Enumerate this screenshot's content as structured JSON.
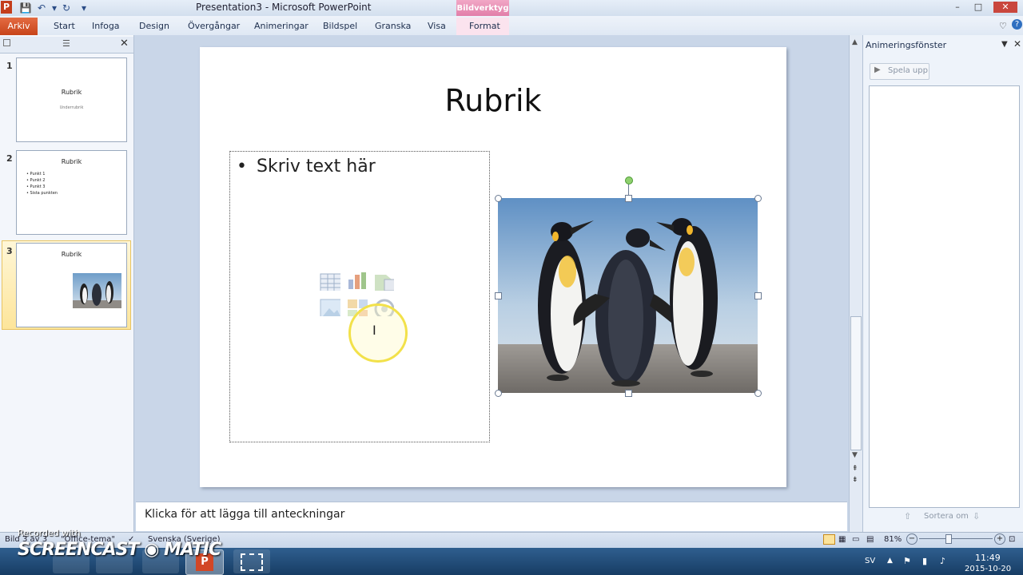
{
  "window": {
    "title": "Presentation3  -  Microsoft PowerPoint",
    "context_tab_group": "Bildverktyg",
    "controls": [
      "–",
      "□",
      "✕"
    ]
  },
  "ribbon": {
    "tabs": [
      "Arkiv",
      "Start",
      "Infoga",
      "Design",
      "Övergångar",
      "Animeringar",
      "Bildspel",
      "Granska",
      "Visa",
      "Format"
    ],
    "active_context_tab": "Format"
  },
  "slides_panel": {
    "thumbnails": [
      {
        "number": "1",
        "title": "Rubrik",
        "subtitle": "Underrubrik"
      },
      {
        "number": "2",
        "title": "Rubrik",
        "bullets": [
          "Punkt 1",
          "Punkt 2",
          "Punkt 3",
          "Sista punkten"
        ]
      },
      {
        "number": "3",
        "title": "Rubrik"
      }
    ],
    "selected_index": 3
  },
  "slide": {
    "title": "Rubrik",
    "bullet_symbol": "•",
    "content_text": "Skriv text här"
  },
  "notes": {
    "placeholder": "Klicka för att lägga till anteckningar"
  },
  "animation_pane": {
    "title": "Animeringsfönster",
    "play_button": "Spela upp",
    "sort_label": "Sortera om"
  },
  "status_bar": {
    "slide_info": "Bild 3 av 3",
    "theme": "\"Office-tema\"",
    "language": "Svenska (Sverige)",
    "zoom": "81%"
  },
  "taskbar": {
    "language": "SV",
    "time": "11:49",
    "date": "2015-10-20"
  },
  "watermark": {
    "line1": "Recorded with",
    "line2": "SCREENCAST ◉ MATIC"
  },
  "colors": {
    "file_tab": "#c7441a",
    "context_tab": "#e07aa6",
    "selected_thumb": "#fde59a"
  }
}
